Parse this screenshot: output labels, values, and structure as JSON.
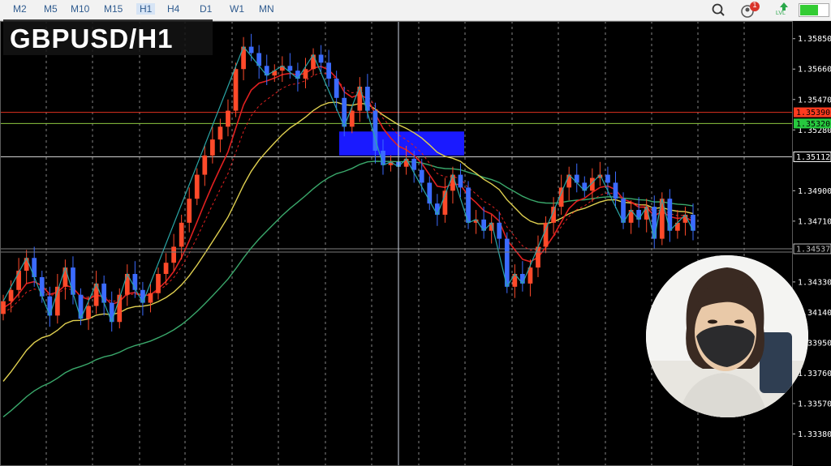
{
  "toolbar": {
    "timeframes": [
      "M2",
      "M5",
      "M10",
      "M15",
      "H1",
      "H4",
      "D1",
      "W1",
      "MN"
    ],
    "active_timeframe": "H1",
    "notification_count": "1",
    "lvl_label": "LVL"
  },
  "title": "GBPUSD/H1",
  "chart_data": {
    "type": "candlestick",
    "symbol": "GBPUSD",
    "timeframe": "H1",
    "ylim": [
      1.3318,
      1.3596
    ],
    "y_ticks": [
      "1.35850",
      "1.35660",
      "1.35470",
      "1.35280",
      "1.34900",
      "1.34710",
      "1.34330",
      "1.34140",
      "1.33950",
      "1.33760",
      "1.33570",
      "1.33380"
    ],
    "price_labels": [
      {
        "value": "1.35390",
        "color": "#ff3b1f",
        "line_color": "#e03020"
      },
      {
        "value": "1.35320",
        "color": "#27c93f",
        "line_color": "#8dc63f"
      },
      {
        "value": "1.35112",
        "color": "#ffffff",
        "line_color": "#d0d0d0"
      },
      {
        "value": "1.34537",
        "color": "#bfbfbf",
        "line_color": "#808080"
      }
    ],
    "zone": {
      "from": 1.3512,
      "to": 1.3527,
      "color": "#1a1aff"
    },
    "colors": {
      "bull": "#ff4a2a",
      "bear": "#3b6bff",
      "ma_fast": "#e02020",
      "ma_mid": "#e0d050",
      "ma_slow": "#3aa86b",
      "zigzag": "#2aa6a6"
    },
    "close_values": [
      1.3421,
      1.3428,
      1.344,
      1.3448,
      1.3436,
      1.3424,
      1.3412,
      1.343,
      1.3442,
      1.3425,
      1.341,
      1.3418,
      1.3432,
      1.342,
      1.3408,
      1.3425,
      1.3438,
      1.3428,
      1.342,
      1.3426,
      1.3438,
      1.3445,
      1.3455,
      1.347,
      1.3485,
      1.35,
      1.3512,
      1.3522,
      1.353,
      1.354,
      1.3566,
      1.358,
      1.3576,
      1.3568,
      1.3562,
      1.3565,
      1.3568,
      1.3565,
      1.356,
      1.3566,
      1.3575,
      1.357,
      1.356,
      1.3548,
      1.353,
      1.354,
      1.3555,
      1.354,
      1.3515,
      1.3506,
      1.3508,
      1.3505,
      1.351,
      1.3503,
      1.3495,
      1.3482,
      1.3475,
      1.349,
      1.35,
      1.3492,
      1.347,
      1.3472,
      1.3465,
      1.347,
      1.346,
      1.343,
      1.3438,
      1.3432,
      1.3442,
      1.3455,
      1.347,
      1.348,
      1.3492,
      1.35,
      1.3495,
      1.349,
      1.3498,
      1.35,
      1.3495,
      1.3485,
      1.347,
      1.3478,
      1.3472,
      1.348,
      1.346,
      1.3485,
      1.3465,
      1.347,
      1.3475,
      1.3465
    ]
  },
  "webcam": {
    "label": "presenter webcam"
  }
}
